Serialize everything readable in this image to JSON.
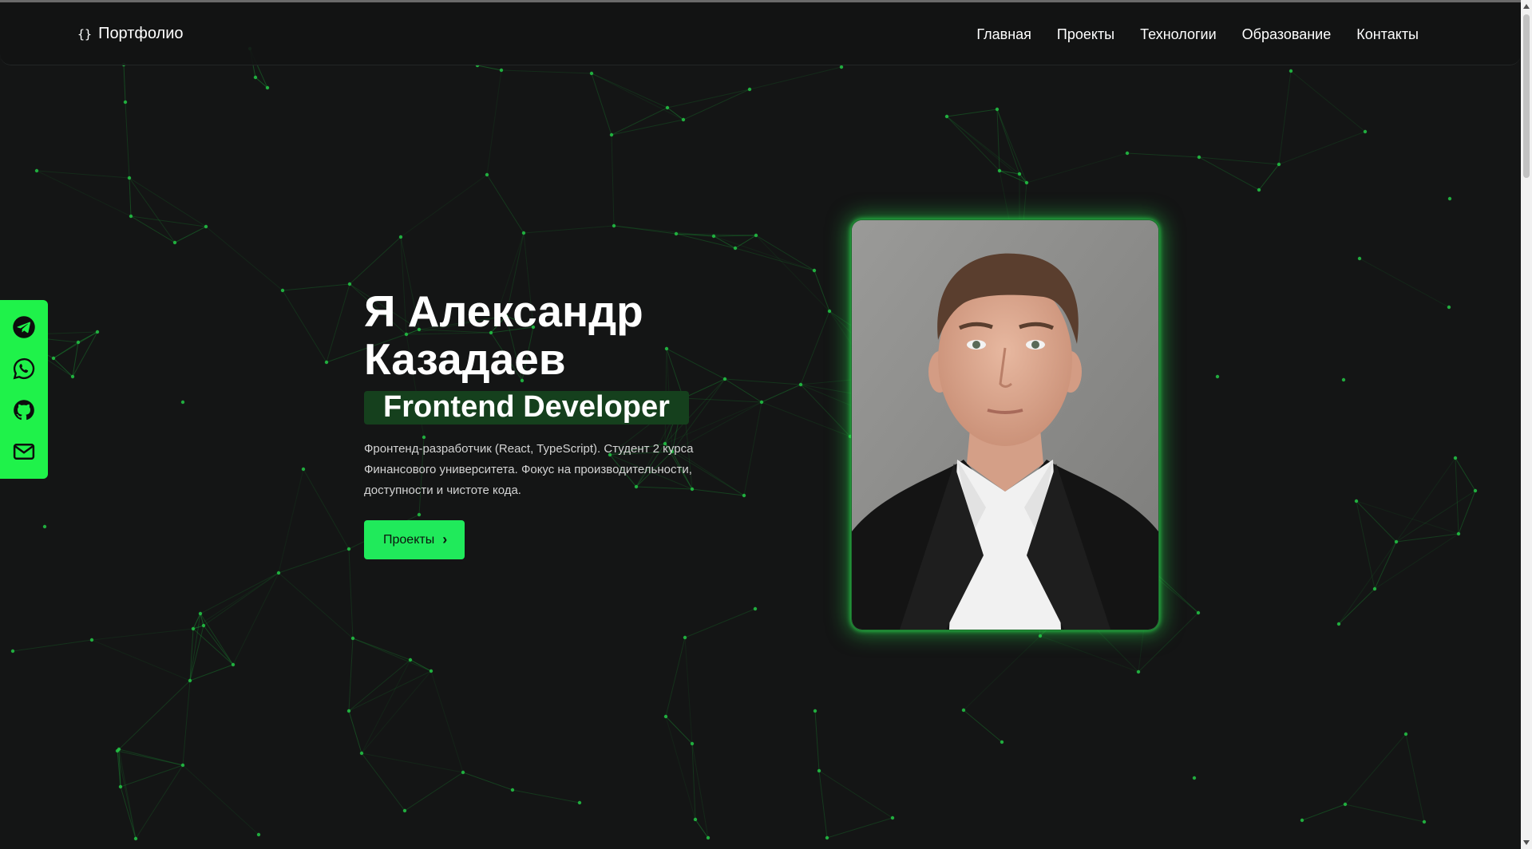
{
  "brand": {
    "icon": "code-braces-icon",
    "name": "Портфолио"
  },
  "nav": {
    "items": [
      {
        "label": "Главная"
      },
      {
        "label": "Проекты"
      },
      {
        "label": "Технологии"
      },
      {
        "label": "Образование"
      },
      {
        "label": "Контакты"
      }
    ]
  },
  "social": {
    "items": [
      {
        "icon": "telegram-icon"
      },
      {
        "icon": "whatsapp-icon"
      },
      {
        "icon": "github-icon"
      },
      {
        "icon": "mail-icon"
      }
    ]
  },
  "hero": {
    "title_line1": "Я Александр",
    "title_line2": "Казадаев",
    "role": "Frontend Developer",
    "description": "Фронтенд-разработчик (React, TypeScript). Студент 2 курса Финансового университета. Фокус на производительности, доступности и чистоте кода.",
    "cta_label": "Проекты"
  },
  "theme": {
    "background": "#141515",
    "accent": "#1ff24a",
    "network_color": "#1a9a36"
  }
}
